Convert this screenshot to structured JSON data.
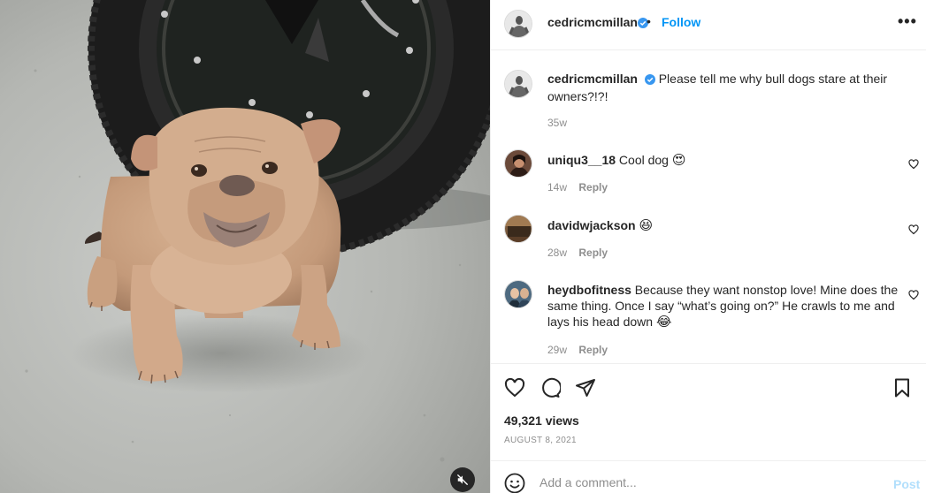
{
  "post": {
    "author": "cedricmcmillan",
    "follow_label": "Follow",
    "dot": "•",
    "more": "•••",
    "caption": "Please tell me why bull dogs stare at their owners?!?!",
    "caption_time": "35w"
  },
  "comments": [
    {
      "user": "uniqu3__18",
      "text": "Cool dog",
      "emoji": "😍",
      "time": "14w",
      "reply": "Reply"
    },
    {
      "user": "davidwjackson",
      "text": "",
      "emoji": "😆",
      "time": "28w",
      "reply": "Reply"
    },
    {
      "user": "heydbofitness",
      "text": "Because they want nonstop love! Mine does the same thing. Once I say “what’s going on?” He crawls to me and lays his head down",
      "emoji": "😂",
      "time": "29w",
      "reply": "Reply"
    }
  ],
  "stats": {
    "views": "49,321 views",
    "date": "AUGUST 8, 2021"
  },
  "composer": {
    "placeholder": "Add a comment...",
    "post_label": "Post"
  },
  "icons": {
    "verified": "verified-badge-icon",
    "heart": "heart-icon",
    "comment": "comment-icon",
    "share": "share-icon",
    "save": "bookmark-icon",
    "emoji": "emoji-icon",
    "mute": "muted-audio-icon",
    "more": "more-options-icon"
  },
  "colors": {
    "accent": "#0095f6",
    "muted": "#8e8e8e",
    "verified": "#3897f0",
    "post_disabled": "#b2dffc"
  }
}
